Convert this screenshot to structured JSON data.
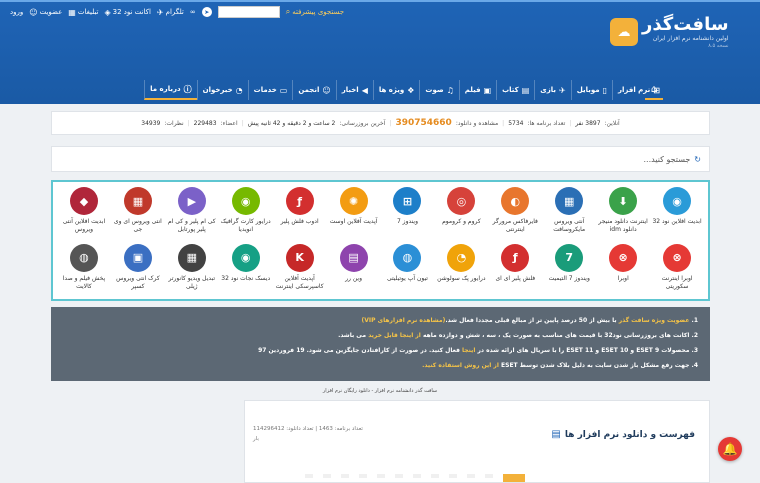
{
  "header": {
    "logo_title": "سافت‌گذر",
    "logo_subtitle": "اولین دانشنامه نرم افزار ایران",
    "logo_version": "نسخه ۸.۵",
    "top_links": {
      "login": "ورود",
      "signup": "عضویت",
      "ads": "تبلیغات",
      "nod32": "اکانت نود 32",
      "telegram": "تلگرام",
      "infinity": "∞",
      "advanced_search": "جستجوی پیشرفته"
    },
    "search": {
      "placeholder": ""
    }
  },
  "nav": {
    "home": "خانه",
    "items": [
      {
        "label": "نرم افزار",
        "icon": "windows-icon"
      },
      {
        "label": "موبایل",
        "icon": "android-icon"
      },
      {
        "label": "بازی",
        "icon": "game-icon"
      },
      {
        "label": "کتاب",
        "icon": "book-icon"
      },
      {
        "label": "فیلم",
        "icon": "film-icon"
      },
      {
        "label": "صوت",
        "icon": "music-icon"
      },
      {
        "label": "ویژه ها",
        "icon": "star-icon"
      },
      {
        "label": "اخبار",
        "icon": "megaphone-icon"
      },
      {
        "label": "انجمن",
        "icon": "users-icon"
      },
      {
        "label": "خدمات",
        "icon": "briefcase-icon"
      },
      {
        "label": "خبرخوان",
        "icon": "rss-icon"
      },
      {
        "label": "درباره ما",
        "icon": "info-icon"
      }
    ]
  },
  "stats": {
    "online_label": "آنلاین:",
    "online": "3897 نفر",
    "programs_label": "تعداد برنامه ها:",
    "programs": "5734",
    "views_label": "مشاهده و دانلود:",
    "views": "390754660",
    "update_label": "آخرین بروزرسانی:",
    "update": "2 ساعت و 2 دقیقه و 42 ثانیه پیش",
    "members_label": "اعضاء:",
    "members": "229483",
    "comments_label": "نظرات:",
    "comments": "34939"
  },
  "main_search": {
    "placeholder": "جستجو کنید..."
  },
  "software": [
    {
      "label": "ابدیت افلاین نود 32",
      "color": "#2a9bd8",
      "glyph": "◉"
    },
    {
      "label": "اینترنت دانلود منیجر دانلود idm",
      "color": "#3aa24a",
      "glyph": "⬇"
    },
    {
      "label": "آنتی ویروس مایکروسافت",
      "color": "#2b6fb5",
      "glyph": "▦"
    },
    {
      "label": "فایرفاکس مرورگر اینترنتی",
      "color": "#e8762d",
      "glyph": "◐"
    },
    {
      "label": "کروم و کروموم",
      "color": "#d6423a",
      "glyph": "◎"
    },
    {
      "label": "ویندوز 7",
      "color": "#1d7fc9",
      "glyph": "⊞"
    },
    {
      "label": "آپدیت آفلاین اوست",
      "color": "#f39c12",
      "glyph": "✺"
    },
    {
      "label": "ادوب فلش پلیر",
      "color": "#d32f2f",
      "glyph": "ƒ"
    },
    {
      "label": "درایور کارت گرافیک انویدیا",
      "color": "#76b900",
      "glyph": "◉"
    },
    {
      "label": "کی ام پلیر و کی ام پلیر پورتابل",
      "color": "#7b61c8",
      "glyph": "▶"
    },
    {
      "label": "انتی ویروس ای وی جی",
      "color": "#c0392b",
      "glyph": "▦"
    },
    {
      "label": "ابدیت افلاین آنتی ویروس",
      "color": "#b0263a",
      "glyph": "◆"
    },
    {
      "label": "اوبرا اینترنت سکوریتی",
      "color": "#e53935",
      "glyph": "⊗"
    },
    {
      "label": "اوبرا",
      "color": "#e53935",
      "glyph": "⊗"
    },
    {
      "label": "ویندوز 7 التیمیت",
      "color": "#1a9c7a",
      "glyph": "7"
    },
    {
      "label": "فلش پلیر ای ای",
      "color": "#d32f2f",
      "glyph": "ƒ"
    },
    {
      "label": "درایور پک سولوشن",
      "color": "#f0a30a",
      "glyph": "◔"
    },
    {
      "label": "تیون آپ یوتیلیتی",
      "color": "#2b8fd6",
      "glyph": "◍"
    },
    {
      "label": "وین رر",
      "color": "#8e44ad",
      "glyph": "▤"
    },
    {
      "label": "آپدیت آفلاین کاسپرسکی اینترنت",
      "color": "#c62828",
      "glyph": "K"
    },
    {
      "label": "دیسک نجات نود 32",
      "color": "#16a085",
      "glyph": "◉"
    },
    {
      "label": "تبدیل ویدیو کانورتر ژیلی",
      "color": "#424242",
      "glyph": "▦"
    },
    {
      "label": "کرک انتی ویروس کسپر",
      "color": "#3b6fc2",
      "glyph": "▣"
    },
    {
      "label": "پخش فیلم و صدا کالایت",
      "color": "#555555",
      "glyph": "◍"
    }
  ],
  "notices": [
    {
      "num": "1.",
      "parts": [
        {
          "t": "عضویت ویژه سافت گذر",
          "y": true
        },
        {
          "t": " با بیش از 50 درصد پایین تر از مبالغ قبلی مجددا فعال شد.",
          "y": false
        },
        {
          "t": "(مشاهده نرم افزارهای VIP)",
          "y": true
        }
      ]
    },
    {
      "num": "2.",
      "parts": [
        {
          "t": "اکانت های بروزرسانی نود32 با قیمت های مناسب به صورت یک ، سه ، شش و دوازده ماهه ",
          "y": false
        },
        {
          "t": "از اینجا قابل خرید",
          "y": true
        },
        {
          "t": " می باشد.",
          "y": false
        }
      ]
    },
    {
      "num": "3.",
      "parts": [
        {
          "t": "محصولات ESET 9 و ESET 10 و ESET 11 را با سریال های ارائه شده در ",
          "y": false
        },
        {
          "t": "اینجا",
          "y": true
        },
        {
          "t": " فعال کنید. در صورت از کارافتادن جایگزین می شود. 19 فروردین 97",
          "y": false
        }
      ]
    },
    {
      "num": "4.",
      "parts": [
        {
          "t": "جهت رفع مشکل باز شدن سایت به دلیل بلاک شدن توسط ESET ",
          "y": false
        },
        {
          "t": "از این روش استفاده کنید.",
          "y": true
        }
      ]
    }
  ],
  "credit": "سافت گذر دانشنامه نرم افزار - دانلود رایگان نرم افزار",
  "list": {
    "title": "فهرست و دانلود نرم افزار ها",
    "programs_label": "تعداد برنامه:",
    "programs": "1463",
    "downloads_label": "تعداد دانلود:",
    "downloads": "114296412",
    "extra": "بار"
  },
  "notify_icon": "bell-icon"
}
